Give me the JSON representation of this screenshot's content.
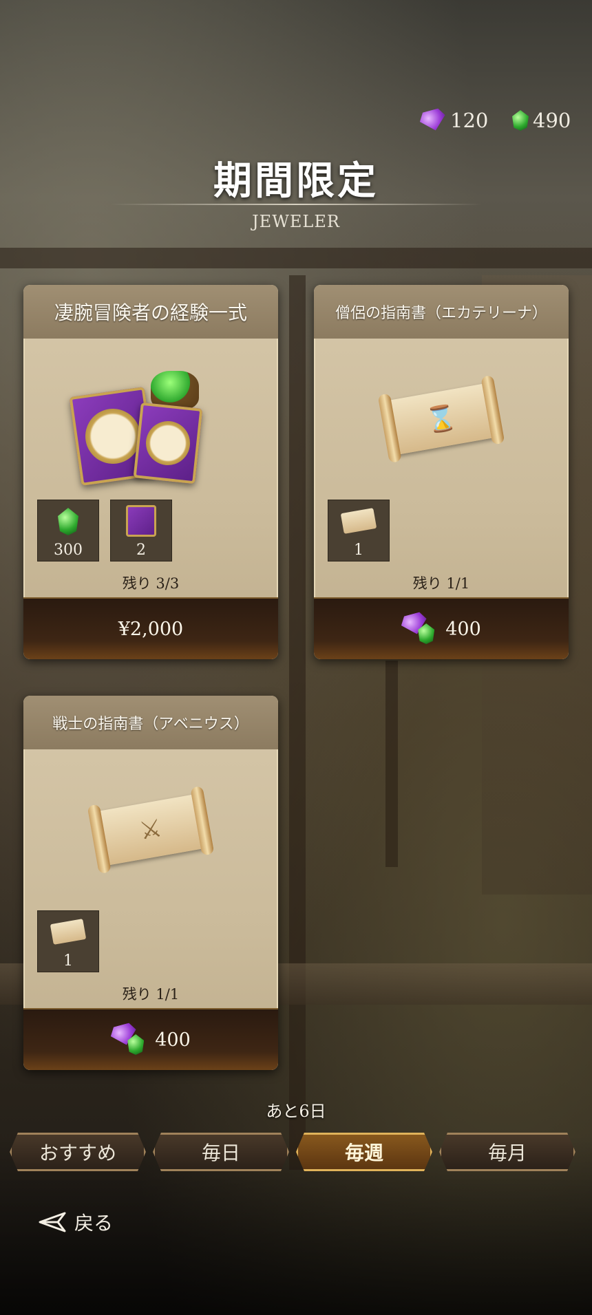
{
  "currency": {
    "premium_gems": "120",
    "green_gems": "490"
  },
  "header": {
    "title": "期間限定",
    "subtitle": "JEWELER"
  },
  "cards": [
    {
      "title": "凄腕冒険者の経験一式",
      "items": [
        {
          "icon": "green-gem-icon",
          "qty": "300"
        },
        {
          "icon": "purple-clock-book-icon",
          "qty": "2"
        }
      ],
      "remaining": "残り 3/3",
      "price": "¥2,000"
    },
    {
      "title": "僧侶の指南書（エカテリーナ）",
      "items": [
        {
          "icon": "scroll-icon",
          "qty": "1"
        }
      ],
      "remaining": "残り 1/1",
      "price": "400"
    },
    {
      "title": "戦士の指南書（アベニウス）",
      "items": [
        {
          "icon": "scroll-icon",
          "qty": "1"
        }
      ],
      "remaining": "残り 1/1",
      "price": "400"
    }
  ],
  "days_left": "あと6日",
  "tabs": [
    {
      "label": "おすすめ",
      "active": false
    },
    {
      "label": "毎日",
      "active": false
    },
    {
      "label": "毎週",
      "active": true
    },
    {
      "label": "毎月",
      "active": false
    }
  ],
  "back_label": "戻る",
  "colors": {
    "card_bg": "#cbbb9b",
    "price_bar": "#3e2614",
    "active_tab": "#8a5a1e"
  }
}
